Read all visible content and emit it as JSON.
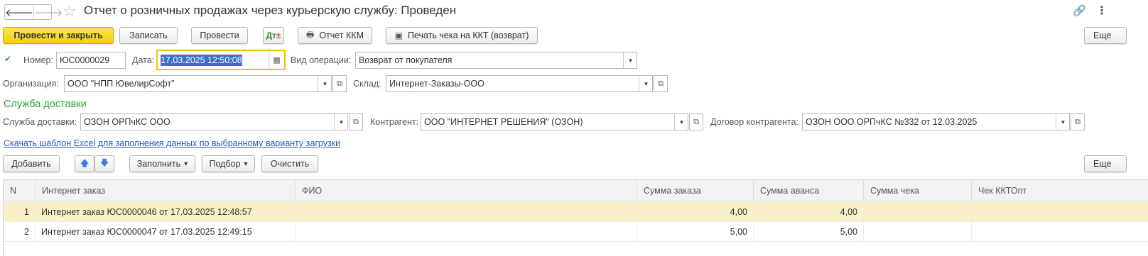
{
  "header": {
    "back_glyph": "🡐",
    "forward_glyph": "🡒",
    "star_glyph": "☆",
    "title": "Отчет о розничных продажах через курьерскую службу: Проведен",
    "link_glyph": "🔗",
    "more_glyph": "⋮"
  },
  "toolbar": {
    "post_close_label": "Провести и закрыть",
    "save_label": "Записать",
    "post_label": "Провести",
    "kkm_report_label": "Отчет ККМ",
    "print_receipt_label": "Печать чека на ККТ (возврат)",
    "more_label": "Еще",
    "print_icon_glyph": "🖶",
    "receipt_icon_glyph": "▣"
  },
  "form": {
    "number_label": "Номер:",
    "number_value": "ЮС0000029",
    "date_label": "Дата:",
    "date_value": "17.03.2025 12:50:08",
    "operation_label": "Вид операции:",
    "operation_value": "Возврат от покупателя",
    "org_label": "Организация:",
    "org_value": "ООО \"НПП ЮвелирСофт\"",
    "warehouse_label": "Склад:",
    "warehouse_value": "Интернет-Заказы-ООО",
    "delivery_section": "Служба доставки",
    "delivery_label": "Служба доставки:",
    "delivery_value": "ОЗОН ОРПчКС ООО",
    "counterparty_label": "Контрагент:",
    "counterparty_value": "ООО \"ИНТЕРНЕТ РЕШЕНИЯ\" (ОЗОН)",
    "contract_label": "Договор контрагента:",
    "contract_value": "ОЗОН ООО ОРПчКС №332 от 12.03.2025",
    "excel_link": "Скачать шаблон Excel для заполнения данных по выбранному варианту загрузки"
  },
  "table_toolbar": {
    "add_label": "Добавить",
    "fill_label": "Заполнить",
    "pick_label": "Подбор",
    "clear_label": "Очистить",
    "more_label": "Еще",
    "dropdown_glyph": "▾",
    "up_glyph": "🡅",
    "down_glyph": "🡇"
  },
  "table": {
    "columns": [
      "N",
      "Интернет заказ",
      "ФИО",
      "Сумма заказа",
      "Сумма аванса",
      "Сумма чека",
      "Чек ККТОпт"
    ],
    "rows": [
      {
        "n": "1",
        "order": "Интернет заказ ЮС0000046 от 17.03.2025 12:48:57",
        "fio": "",
        "order_sum": "4,00",
        "advance_sum": "4,00",
        "check_sum": "",
        "kkt": ""
      },
      {
        "n": "2",
        "order": "Интернет заказ ЮС0000047 от 17.03.2025 12:49:15",
        "fio": "",
        "order_sum": "5,00",
        "advance_sum": "5,00",
        "check_sum": "",
        "kkt": ""
      }
    ]
  },
  "colors": {
    "primary_button": "#f4cf0a",
    "section_title": "#2aa236",
    "link": "#2d58b8",
    "selected_row": "#fbf0c7",
    "date_focus": "#f5c000"
  }
}
